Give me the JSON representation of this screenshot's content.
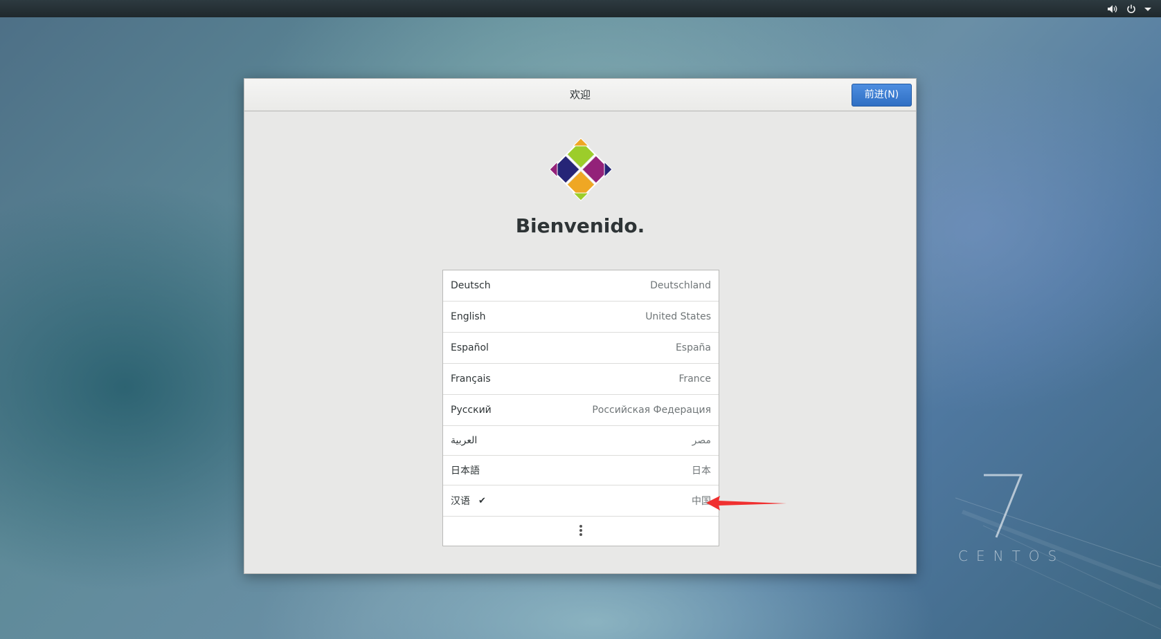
{
  "topbar": {
    "icons": [
      "volume-icon",
      "power-icon",
      "dropdown-arrow-icon"
    ]
  },
  "dialog": {
    "title": "欢迎",
    "next_button": "前进(N)",
    "heading": "Bienvenido.",
    "logo_icon": "centos-logo-icon"
  },
  "languages": [
    {
      "name": "Deutsch",
      "country": "Deutschland",
      "selected": false
    },
    {
      "name": "English",
      "country": "United States",
      "selected": false
    },
    {
      "name": "Español",
      "country": "España",
      "selected": false
    },
    {
      "name": "Français",
      "country": "France",
      "selected": false
    },
    {
      "name": "Русский",
      "country": "Российская Федерация",
      "selected": false
    },
    {
      "name": "العربية",
      "country": "مصر",
      "selected": false
    },
    {
      "name": "日本語",
      "country": "日本",
      "selected": false
    },
    {
      "name": "汉语",
      "country": "中国",
      "selected": true,
      "check": "✔"
    }
  ],
  "more_icon": "vertical-ellipsis-icon",
  "desktop": {
    "brand_number": "7",
    "brand_word": "CENTOS"
  },
  "colors": {
    "accent": "#3579d0",
    "annotation_arrow": "#f03030"
  }
}
